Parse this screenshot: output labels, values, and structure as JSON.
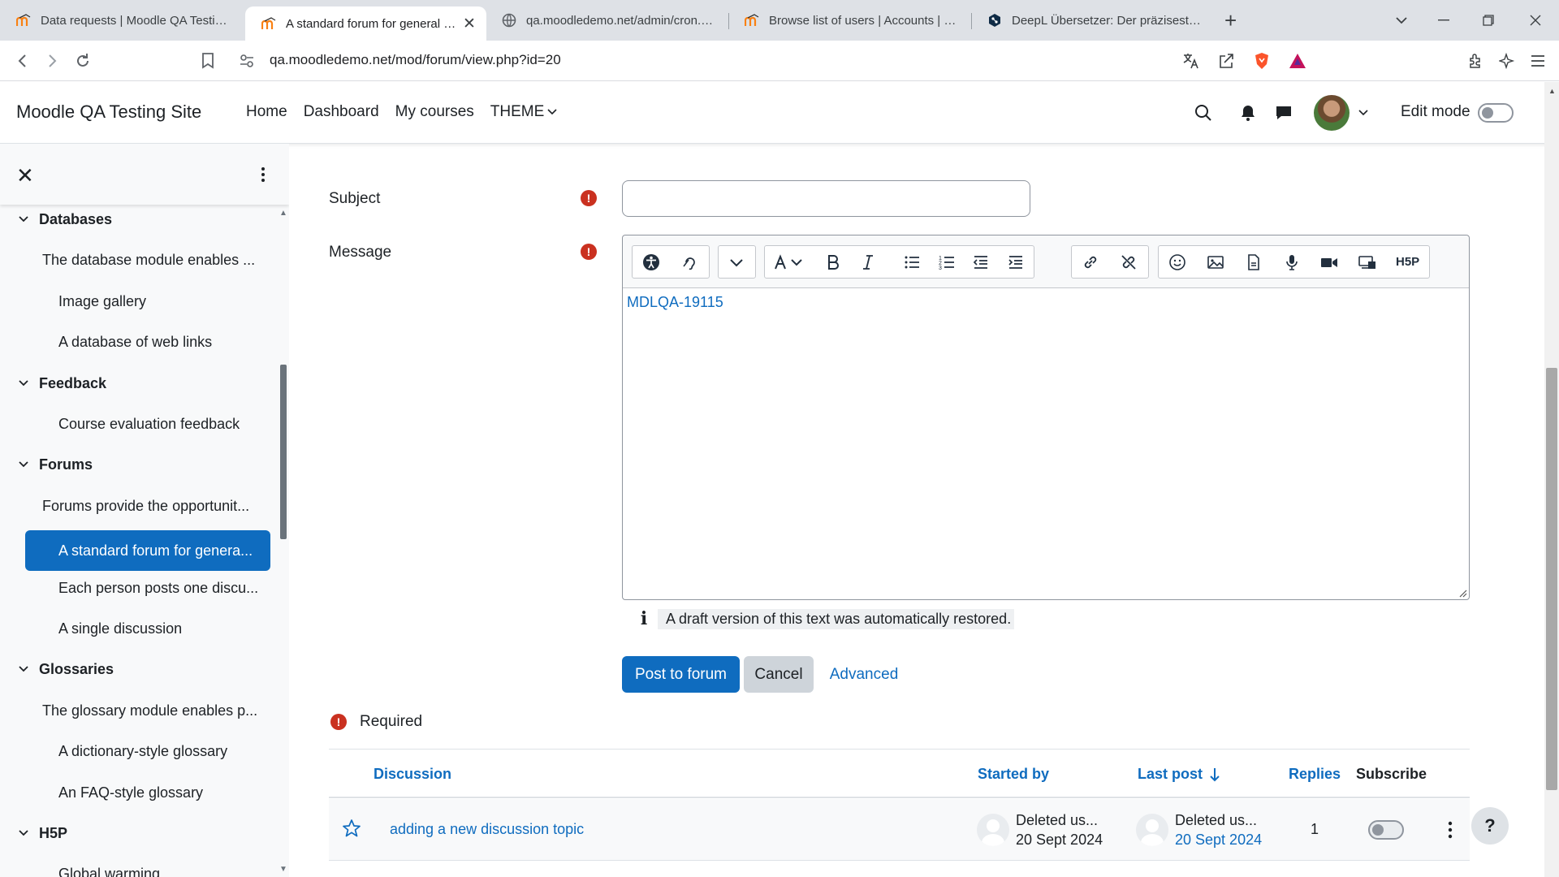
{
  "browser": {
    "tabs": [
      {
        "title": "Data requests | Moodle QA Testing Site",
        "icon": "moodle-favicon"
      },
      {
        "title": "A standard forum for general use",
        "icon": "moodle-favicon",
        "active": true
      },
      {
        "title": "qa.moodledemo.net/admin/cron.php",
        "icon": "globe-icon"
      },
      {
        "title": "Browse list of users | Accounts | Users",
        "icon": "moodle-favicon"
      },
      {
        "title": "DeepL Übersetzer: Der präziseste Übersetzer",
        "icon": "deepl-icon"
      }
    ],
    "url": "qa.moodledemo.net/mod/forum/view.php?id=20"
  },
  "navbar": {
    "brand": "Moodle QA Testing Site",
    "links": [
      "Home",
      "Dashboard",
      "My courses",
      "THEME"
    ],
    "edit_mode_label": "Edit mode"
  },
  "drawer": {
    "items": [
      {
        "text": "Databases",
        "type": "section"
      },
      {
        "text": "The database module enables ...",
        "type": "desc"
      },
      {
        "text": "Image gallery",
        "type": "link"
      },
      {
        "text": "A database of web links",
        "type": "link"
      },
      {
        "text": "Feedback",
        "type": "section"
      },
      {
        "text": "Course evaluation feedback",
        "type": "link"
      },
      {
        "text": "Forums",
        "type": "section"
      },
      {
        "text": "Forums provide the opportunit...",
        "type": "desc"
      },
      {
        "text": "A standard forum for genera...",
        "type": "active"
      },
      {
        "text": "Each person posts one discu...",
        "type": "link"
      },
      {
        "text": "A single discussion",
        "type": "link"
      },
      {
        "text": "Glossaries",
        "type": "section"
      },
      {
        "text": "The glossary module enables p...",
        "type": "desc"
      },
      {
        "text": "A dictionary-style glossary",
        "type": "link"
      },
      {
        "text": "An FAQ-style glossary",
        "type": "link"
      },
      {
        "text": "H5P",
        "type": "section"
      },
      {
        "text": "Global warming",
        "type": "link"
      }
    ]
  },
  "form": {
    "subject_label": "Subject",
    "subject_value": "",
    "message_label": "Message",
    "message_content": "MDLQA-19115",
    "draft_notice": "A draft version of this text was automatically restored.",
    "post_button": "Post to forum",
    "cancel_button": "Cancel",
    "advanced_link": "Advanced",
    "required_label": "Required"
  },
  "table": {
    "headers": {
      "discussion": "Discussion",
      "started_by": "Started by",
      "last_post": "Last post",
      "replies": "Replies",
      "subscribe": "Subscribe"
    },
    "rows": [
      {
        "topic": "adding a new discussion topic",
        "started_by": "Deleted us...",
        "started_date": "20 Sept 2024",
        "last_by": "Deleted us...",
        "last_date": "20 Sept 2024",
        "replies": "1"
      }
    ]
  },
  "help_button": "?",
  "colors": {
    "primary": "#0f6cbf",
    "error": "#ca3120",
    "drawer_bg": "#f8f9fa"
  }
}
